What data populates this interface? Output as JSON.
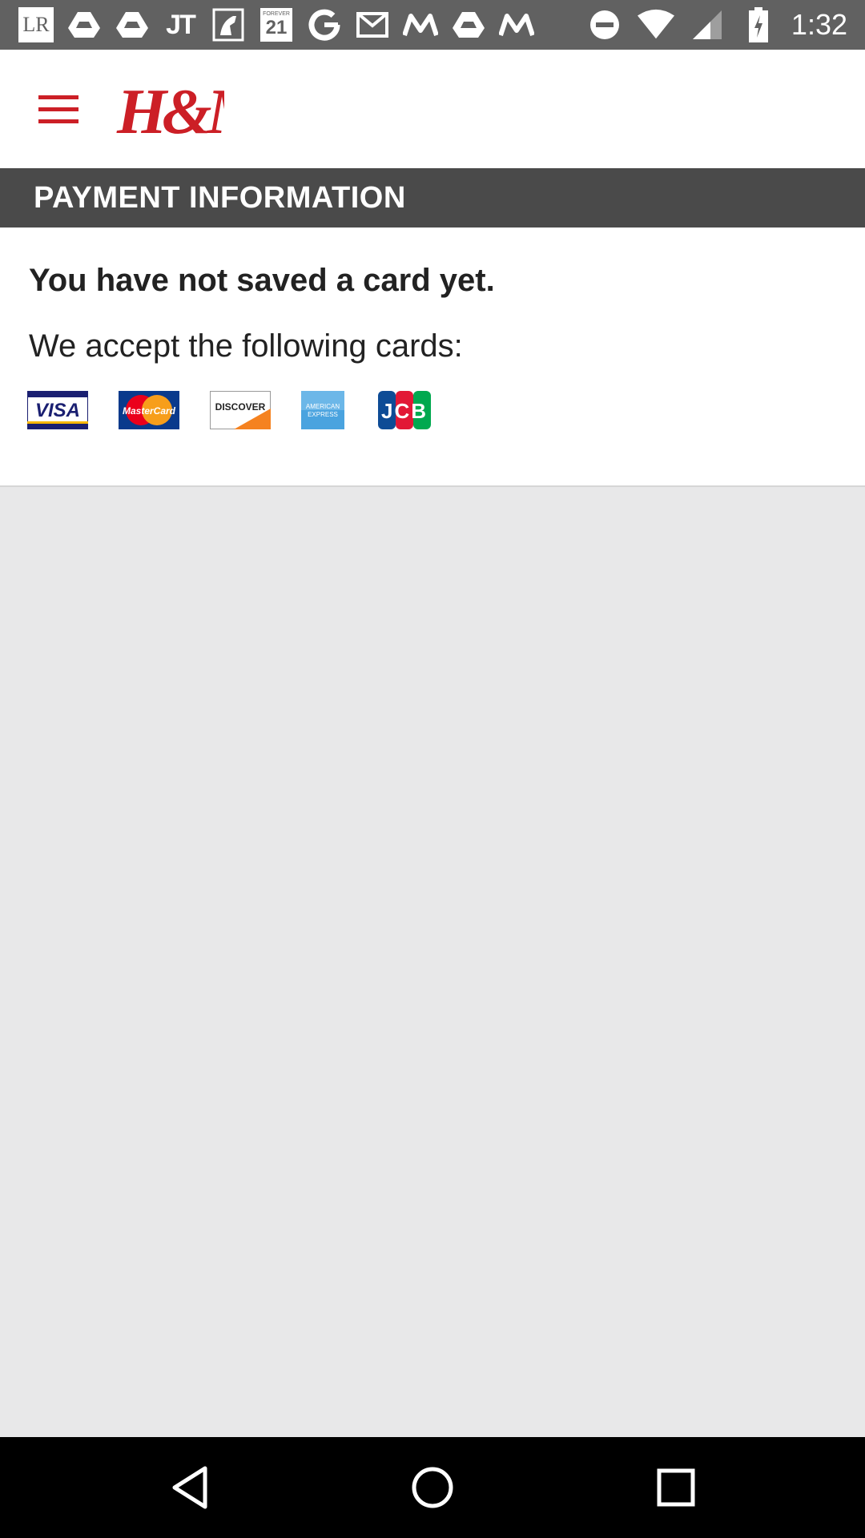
{
  "status_bar": {
    "time": "1:32",
    "notification_icons": [
      "lr-icon",
      "drive-icon",
      "drive-icon",
      "jt-icon",
      "image-icon",
      "forever21-icon",
      "google-icon",
      "gmail-icon",
      "myntra-icon",
      "drive-icon",
      "myntra-icon"
    ],
    "lr_text": "LR",
    "forever21_top": "FOREVER",
    "forever21_num": "21",
    "jt_text": "JT"
  },
  "app_bar": {
    "logo_text": "H&M",
    "brand_color": "#cc1f26"
  },
  "section": {
    "title": "PAYMENT INFORMATION"
  },
  "content": {
    "no_card_message": "You have not saved a card yet.",
    "accept_label": "We accept the following cards:",
    "cards": [
      {
        "name": "visa",
        "text": "VISA"
      },
      {
        "name": "mastercard",
        "text": "MasterCard"
      },
      {
        "name": "discover",
        "text": "DISCOVER"
      },
      {
        "name": "american-express",
        "text_line1": "AMERICAN",
        "text_line2": "EXPRESS"
      },
      {
        "name": "jcb",
        "text": "JCB"
      }
    ]
  },
  "nav_bar": {
    "buttons": [
      "back",
      "home",
      "recents"
    ]
  }
}
